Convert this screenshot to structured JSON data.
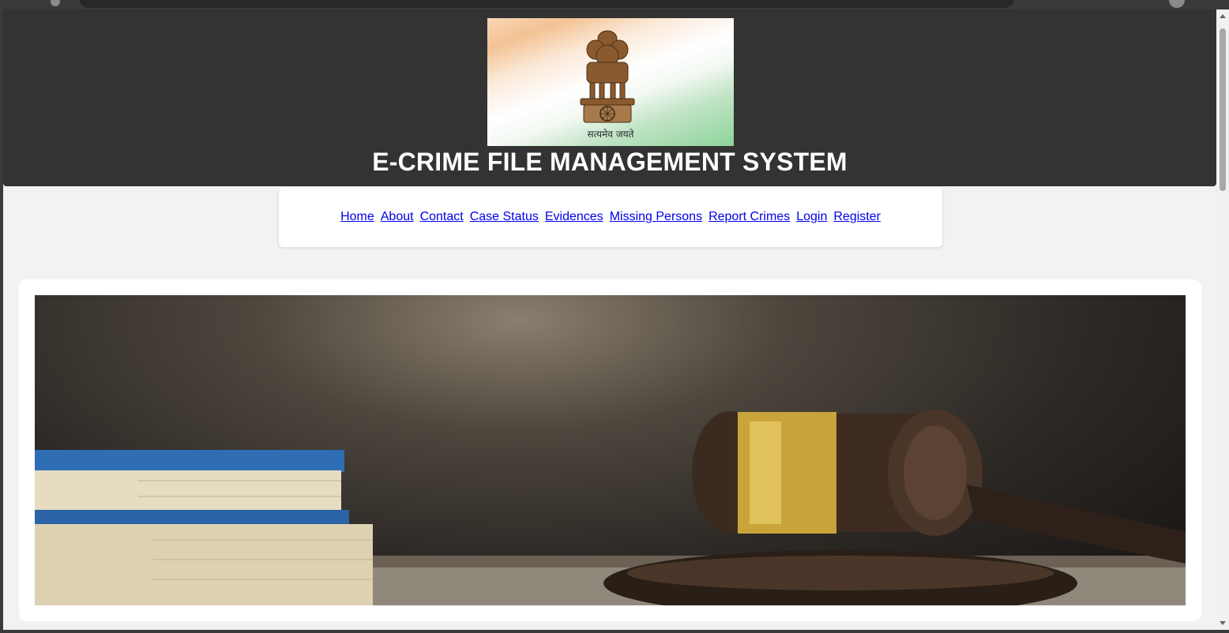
{
  "emblem": {
    "motto": "सत्यमेव जयते",
    "icon": "state-emblem-icon"
  },
  "header": {
    "title": "E-CRIME FILE MANAGEMENT SYSTEM"
  },
  "nav": {
    "items": [
      {
        "label": "Home"
      },
      {
        "label": "About"
      },
      {
        "label": "Contact"
      },
      {
        "label": "Case Status"
      },
      {
        "label": "Evidences"
      },
      {
        "label": "Missing Persons"
      },
      {
        "label": "Report Crimes"
      },
      {
        "label": "Login"
      },
      {
        "label": "Register"
      }
    ]
  },
  "hero": {
    "icon": "gavel-and-books-image"
  },
  "colors": {
    "header_bg": "#333333",
    "page_bg": "#f2f2f2",
    "link": "#0000ee"
  }
}
